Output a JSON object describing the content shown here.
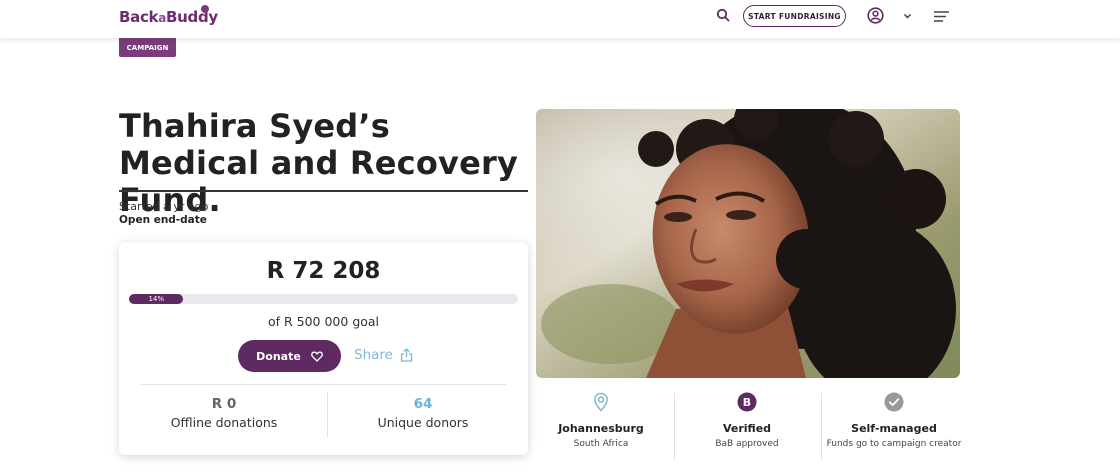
{
  "header": {
    "logo_main": "Back",
    "logo_a": "a",
    "logo_tail": "Buddy",
    "start_label": "START FUNDRAISING"
  },
  "campaign_tag": "CAMPAIGN",
  "title": "Thahira Syed’s Medical and Recovery Fund.",
  "started": "Started a yr ago",
  "end_date": "Open end-date",
  "card": {
    "raised": "R 72 208",
    "progress_percent": 14,
    "progress_label": "14%",
    "goal": "of R 500 000 goal",
    "donate_label": "Donate",
    "share_label": "Share",
    "offline": {
      "value": "R 0",
      "label": "Offline donations"
    },
    "donors": {
      "value": "64",
      "label": "Unique donors"
    }
  },
  "info": [
    {
      "head": "Johannesburg",
      "sub": "South Africa",
      "icon": "location-pin-icon"
    },
    {
      "head": "Verified",
      "sub": "BaB approved",
      "icon": "verified-b-icon",
      "badge": "B"
    },
    {
      "head": "Self-managed",
      "sub": "Funds go to campaign creator",
      "icon": "check-circle-icon"
    }
  ],
  "colors": {
    "brand": "#5e2a61",
    "accent_blue": "#7fb7d3",
    "donors_blue": "#6fb2d8",
    "offline_grey": "#666666"
  }
}
